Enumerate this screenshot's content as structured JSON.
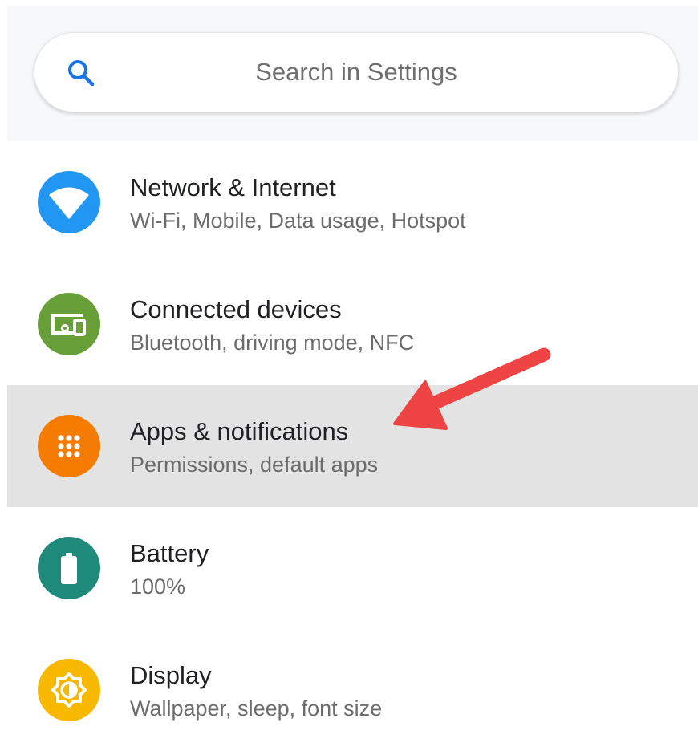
{
  "search": {
    "placeholder": "Search in Settings",
    "icon": "search-icon"
  },
  "colors": {
    "search_icon": "#1a73e8",
    "highlight_row": "#e3e3e3",
    "arrow": "#ef4444"
  },
  "settings": [
    {
      "title": "Network & Internet",
      "subtitle": "Wi-Fi, Mobile, Data usage, Hotspot",
      "icon": "wifi-icon",
      "color": "#2196f3",
      "highlighted": false
    },
    {
      "title": "Connected devices",
      "subtitle": "Bluetooth, driving mode, NFC",
      "icon": "connected-devices-icon",
      "color": "#689f38",
      "highlighted": false
    },
    {
      "title": "Apps & notifications",
      "subtitle": "Permissions, default apps",
      "icon": "apps-grid-icon",
      "color": "#f57c00",
      "highlighted": true
    },
    {
      "title": "Battery",
      "subtitle": "100%",
      "icon": "battery-icon",
      "color": "#1e8a7a",
      "highlighted": false
    },
    {
      "title": "Display",
      "subtitle": "Wallpaper, sleep, font size",
      "icon": "brightness-icon",
      "color": "#f9b800",
      "highlighted": false
    }
  ]
}
